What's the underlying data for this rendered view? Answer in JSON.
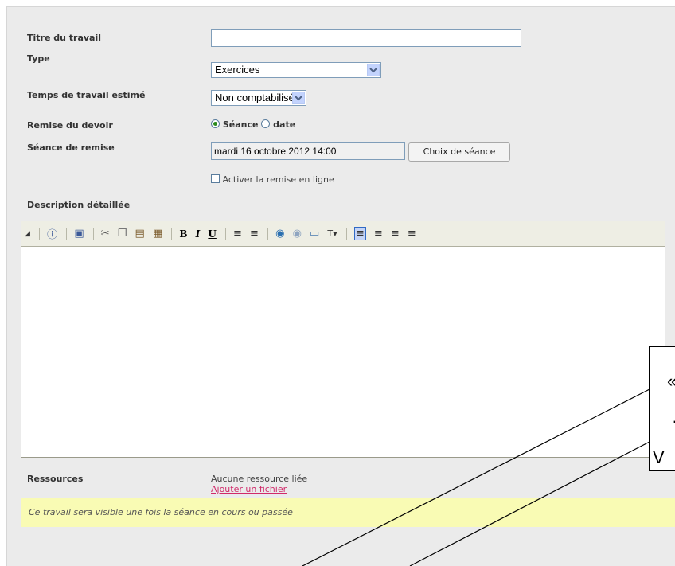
{
  "form": {
    "title_label": "Titre du travail",
    "title_value": "",
    "type_label": "Type",
    "type_value": "Exercices",
    "time_label": "Temps de travail estimé",
    "time_value": "Non comptabilisé",
    "remise_label": "Remise du devoir",
    "remise_option_seance": "Séance",
    "remise_option_date": "date",
    "seance_label": "Séance de remise",
    "seance_value": "mardi 16 octobre 2012 14:00",
    "seance_button": "Choix de séance",
    "online_checkbox_label": "Activer la remise en ligne",
    "description_label": "Description détaillée"
  },
  "editor": {
    "toolbar_icons": [
      "collapse-icon",
      "help-icon",
      "source-icon",
      "cut-icon",
      "copy-icon",
      "paste-icon",
      "paste-word-icon",
      "bold-icon",
      "italic-icon",
      "underline-icon",
      "ordered-list-icon",
      "unordered-list-icon",
      "link-icon",
      "unlink-icon",
      "image-icon",
      "text-color-icon",
      "align-left-icon",
      "align-center-icon",
      "align-right-icon",
      "align-justify-icon"
    ],
    "bold": "B",
    "italic": "I",
    "underline": "U",
    "content": ""
  },
  "resources": {
    "label": "Ressources",
    "none_text": "Aucune ressource liée",
    "add_link": "Ajouter un fichier"
  },
  "notice": "Ce travail sera visible une fois la séance en cours ou passée",
  "callout": {
    "line1": "«",
    "line2": "·",
    "line3": "V"
  },
  "colors": {
    "panel": "#ebebeb",
    "notice_bg": "#f9fbb4",
    "link": "#d12a6a",
    "radio_checked": "#2b8a1b"
  }
}
